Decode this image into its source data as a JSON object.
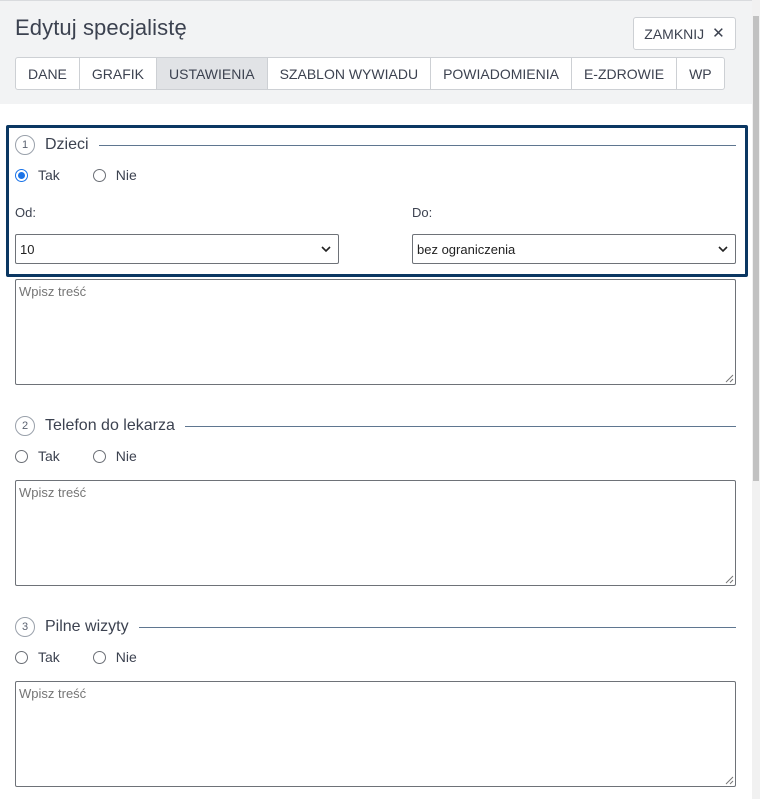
{
  "header": {
    "title": "Edytuj specjalistę",
    "close_label": "ZAMKNIJ"
  },
  "tabs": [
    {
      "label": "DANE",
      "active": false
    },
    {
      "label": "GRAFIK",
      "active": false
    },
    {
      "label": "USTAWIENIA",
      "active": true
    },
    {
      "label": "SZABLON WYWIADU",
      "active": false
    },
    {
      "label": "POWIADOMIENIA",
      "active": false
    },
    {
      "label": "E-ZDROWIE",
      "active": false
    },
    {
      "label": "WP",
      "active": false
    }
  ],
  "sections": [
    {
      "number": "1",
      "label": "Dzieci",
      "yes_label": "Tak",
      "no_label": "Nie",
      "selected": "Tak",
      "from_label": "Od:",
      "from_value": "10",
      "to_label": "Do:",
      "to_value": "bez ograniczenia",
      "textarea_placeholder": "Wpisz treść"
    },
    {
      "number": "2",
      "label": "Telefon do lekarza",
      "yes_label": "Tak",
      "no_label": "Nie",
      "selected": null,
      "textarea_placeholder": "Wpisz treść"
    },
    {
      "number": "3",
      "label": "Pilne wizyty",
      "yes_label": "Tak",
      "no_label": "Nie",
      "selected": null,
      "textarea_placeholder": "Wpisz treść"
    }
  ],
  "colors": {
    "highlight_border": "#0b3762",
    "radio_checked": "#1a73e8",
    "active_tab_bg": "#e1e3e6"
  }
}
